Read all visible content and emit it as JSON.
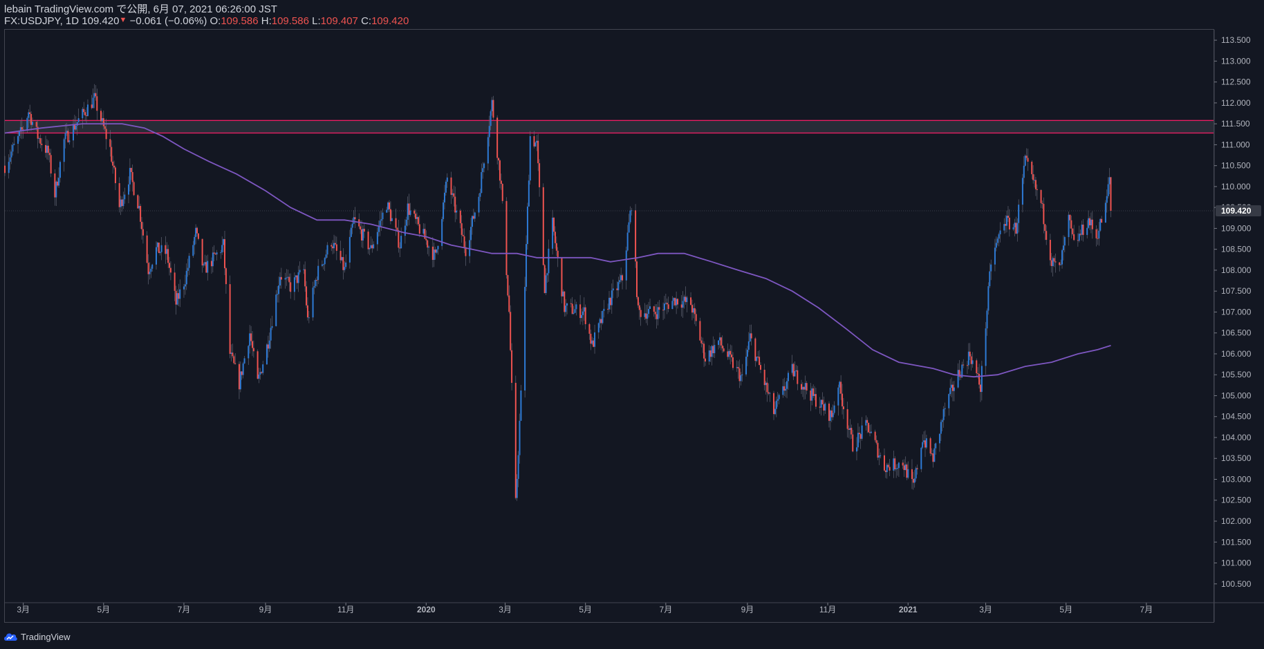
{
  "header": {
    "published": "lebain TradingView.com で公開, 6月 07, 2021 06:26:00 JST",
    "symbol": "FX:USDJPY, 1D",
    "last": "109.420",
    "change": "−0.061 (−0.06%)",
    "o_label": "O:",
    "o_value": "109.586",
    "h_label": "H:",
    "h_value": "109.586",
    "l_label": "L:",
    "l_value": "109.407",
    "c_label": "C:",
    "c_value": "109.420"
  },
  "footer": {
    "brand": "TradingView",
    "logo_icon": "tradingview-cloud-icon"
  },
  "colors": {
    "up": "#2e7bd6",
    "down": "#ef5350",
    "ma": "#7e57c2",
    "zone": "#e91e63",
    "last_price_tag": "#363a45"
  },
  "chart_data": {
    "type": "candlestick",
    "symbol": "FX:USDJPY",
    "interval": "1D",
    "y_axis_ticks": [
      "113.500",
      "113.000",
      "112.500",
      "112.000",
      "111.500",
      "111.000",
      "110.500",
      "110.000",
      "109.500",
      "109.000",
      "108.500",
      "108.000",
      "107.500",
      "107.000",
      "106.500",
      "106.000",
      "105.500",
      "105.000",
      "104.500",
      "104.000",
      "103.500",
      "103.000",
      "102.500",
      "102.000",
      "101.500",
      "101.000",
      "100.500"
    ],
    "ylim": [
      100.05,
      113.75
    ],
    "x_axis_ticks": [
      "3月",
      "5月",
      "7月",
      "9月",
      "11月",
      "2020",
      "3月",
      "5月",
      "7月",
      "9月",
      "11月",
      "2021",
      "3月",
      "5月",
      "7月"
    ],
    "x_tick_dates": [
      "2019-03-01",
      "2019-05-01",
      "2019-07-01",
      "2019-09-01",
      "2019-11-01",
      "2020-01-01",
      "2020-03-01",
      "2020-05-01",
      "2020-07-01",
      "2020-09-01",
      "2020-11-01",
      "2021-01-01",
      "2021-03-01",
      "2021-05-01",
      "2021-07-01"
    ],
    "xlim": [
      "2019-02-15",
      "2021-08-21"
    ],
    "last_price_label": "109.420",
    "last_price": 109.42,
    "resistance_zone": {
      "top": 111.58,
      "bottom": 111.28
    },
    "price_path": [
      [
        "2019-02-15",
        110.5
      ],
      [
        "2019-03-01",
        111.4
      ],
      [
        "2019-03-05",
        111.8
      ],
      [
        "2019-03-12",
        111.2
      ],
      [
        "2019-03-20",
        110.8
      ],
      [
        "2019-03-25",
        109.8
      ],
      [
        "2019-04-01",
        111.1
      ],
      [
        "2019-04-10",
        111.5
      ],
      [
        "2019-04-24",
        112.1
      ],
      [
        "2019-05-01",
        111.4
      ],
      [
        "2019-05-06",
        110.9
      ],
      [
        "2019-05-13",
        109.5
      ],
      [
        "2019-05-21",
        110.3
      ],
      [
        "2019-05-28",
        109.5
      ],
      [
        "2019-06-04",
        108.0
      ],
      [
        "2019-06-10",
        108.5
      ],
      [
        "2019-06-18",
        108.4
      ],
      [
        "2019-06-25",
        107.2
      ],
      [
        "2019-07-02",
        107.8
      ],
      [
        "2019-07-10",
        108.9
      ],
      [
        "2019-07-16",
        108.0
      ],
      [
        "2019-07-24",
        108.3
      ],
      [
        "2019-07-31",
        108.6
      ],
      [
        "2019-08-05",
        106.0
      ],
      [
        "2019-08-12",
        105.3
      ],
      [
        "2019-08-20",
        106.5
      ],
      [
        "2019-08-26",
        105.3
      ],
      [
        "2019-09-03",
        106.3
      ],
      [
        "2019-09-12",
        107.9
      ],
      [
        "2019-09-20",
        107.6
      ],
      [
        "2019-09-30",
        108.0
      ],
      [
        "2019-10-03",
        106.8
      ],
      [
        "2019-10-10",
        107.9
      ],
      [
        "2019-10-21",
        108.7
      ],
      [
        "2019-10-31",
        108.0
      ],
      [
        "2019-11-07",
        109.2
      ],
      [
        "2019-11-20",
        108.5
      ],
      [
        "2019-12-02",
        109.6
      ],
      [
        "2019-12-12",
        108.6
      ],
      [
        "2019-12-18",
        109.5
      ],
      [
        "2020-01-01",
        108.7
      ],
      [
        "2020-01-08",
        108.3
      ],
      [
        "2020-01-17",
        110.2
      ],
      [
        "2020-01-31",
        108.5
      ],
      [
        "2020-02-10",
        109.8
      ],
      [
        "2020-02-20",
        112.0
      ],
      [
        "2020-02-27",
        110.0
      ],
      [
        "2020-03-04",
        107.0
      ],
      [
        "2020-03-09",
        102.4
      ],
      [
        "2020-03-13",
        105.0
      ],
      [
        "2020-03-20",
        111.2
      ],
      [
        "2020-03-25",
        111.0
      ],
      [
        "2020-03-31",
        107.6
      ],
      [
        "2020-04-06",
        109.1
      ],
      [
        "2020-04-15",
        107.1
      ],
      [
        "2020-04-30",
        107.0
      ],
      [
        "2020-05-06",
        106.2
      ],
      [
        "2020-05-18",
        107.2
      ],
      [
        "2020-05-29",
        107.8
      ],
      [
        "2020-06-05",
        109.6
      ],
      [
        "2020-06-10",
        107.0
      ],
      [
        "2020-06-24",
        107.0
      ],
      [
        "2020-07-08",
        107.3
      ],
      [
        "2020-07-20",
        107.2
      ],
      [
        "2020-07-31",
        105.9
      ],
      [
        "2020-08-10",
        106.3
      ],
      [
        "2020-08-20",
        105.8
      ],
      [
        "2020-08-28",
        105.4
      ],
      [
        "2020-09-03",
        106.4
      ],
      [
        "2020-09-21",
        104.6
      ],
      [
        "2020-10-05",
        105.6
      ],
      [
        "2020-10-20",
        105.0
      ],
      [
        "2020-11-04",
        104.5
      ],
      [
        "2020-11-09",
        105.3
      ],
      [
        "2020-11-20",
        103.8
      ],
      [
        "2020-12-01",
        104.3
      ],
      [
        "2020-12-14",
        103.3
      ],
      [
        "2020-12-28",
        103.4
      ],
      [
        "2021-01-05",
        102.8
      ],
      [
        "2021-01-12",
        104.0
      ],
      [
        "2021-01-20",
        103.5
      ],
      [
        "2021-01-29",
        104.7
      ],
      [
        "2021-02-08",
        105.5
      ],
      [
        "2021-02-17",
        106.0
      ],
      [
        "2021-02-25",
        105.2
      ],
      [
        "2021-03-05",
        108.2
      ],
      [
        "2021-03-15",
        109.2
      ],
      [
        "2021-03-24",
        109.0
      ],
      [
        "2021-03-31",
        110.6
      ],
      [
        "2021-04-12",
        109.6
      ],
      [
        "2021-04-20",
        108.2
      ],
      [
        "2021-04-26",
        108.0
      ],
      [
        "2021-05-03",
        109.2
      ],
      [
        "2021-05-07",
        108.6
      ],
      [
        "2021-05-18",
        109.2
      ],
      [
        "2021-05-24",
        108.8
      ],
      [
        "2021-05-31",
        109.5
      ],
      [
        "2021-06-03",
        110.2
      ],
      [
        "2021-06-04",
        109.42
      ]
    ],
    "ma_path": [
      [
        "2019-02-15",
        111.28
      ],
      [
        "2019-03-15",
        111.4
      ],
      [
        "2019-04-15",
        111.5
      ],
      [
        "2019-05-15",
        111.5
      ],
      [
        "2019-06-01",
        111.4
      ],
      [
        "2019-06-15",
        111.2
      ],
      [
        "2019-07-01",
        110.9
      ],
      [
        "2019-07-20",
        110.6
      ],
      [
        "2019-08-10",
        110.3
      ],
      [
        "2019-09-01",
        109.9
      ],
      [
        "2019-09-20",
        109.5
      ],
      [
        "2019-10-10",
        109.2
      ],
      [
        "2019-10-31",
        109.2
      ],
      [
        "2019-11-20",
        109.1
      ],
      [
        "2019-12-15",
        108.9
      ],
      [
        "2020-01-01",
        108.8
      ],
      [
        "2020-01-20",
        108.6
      ],
      [
        "2020-02-05",
        108.5
      ],
      [
        "2020-02-20",
        108.4
      ],
      [
        "2020-03-10",
        108.4
      ],
      [
        "2020-03-25",
        108.3
      ],
      [
        "2020-04-15",
        108.3
      ],
      [
        "2020-05-05",
        108.3
      ],
      [
        "2020-05-20",
        108.2
      ],
      [
        "2020-06-10",
        108.3
      ],
      [
        "2020-06-25",
        108.4
      ],
      [
        "2020-07-15",
        108.4
      ],
      [
        "2020-08-05",
        108.2
      ],
      [
        "2020-08-25",
        108.0
      ],
      [
        "2020-09-15",
        107.8
      ],
      [
        "2020-10-05",
        107.5
      ],
      [
        "2020-10-25",
        107.1
      ],
      [
        "2020-11-15",
        106.6
      ],
      [
        "2020-12-05",
        106.1
      ],
      [
        "2020-12-25",
        105.8
      ],
      [
        "2021-01-20",
        105.65
      ],
      [
        "2021-02-05",
        105.5
      ],
      [
        "2021-02-20",
        105.45
      ],
      [
        "2021-03-10",
        105.5
      ],
      [
        "2021-03-31",
        105.7
      ],
      [
        "2021-04-20",
        105.8
      ],
      [
        "2021-05-10",
        106.0
      ],
      [
        "2021-05-25",
        106.1
      ],
      [
        "2021-06-04",
        106.2
      ]
    ],
    "up_color": "#2e7bd6",
    "down_color": "#ef5350",
    "ma_color": "#7e57c2"
  }
}
